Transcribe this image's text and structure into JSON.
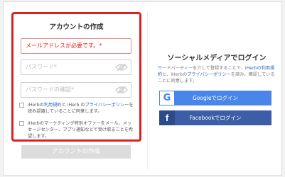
{
  "signup": {
    "title": "アカウントの作成",
    "email_error": "メールアドレスが必要です。*",
    "password_placeholder": "パスワード*",
    "password_confirm_placeholder": "パスワードの確認*",
    "terms": {
      "prefix": "iHerbの",
      "terms_link": "利用規約",
      "middle": "と iHerb の",
      "privacy_link": "プライバシーポリシー",
      "suffix": "を読み認識していることに同意します。"
    },
    "marketing_text": "iHerbのマーケティング特別オファーをメール、メッセージセンター、アプリ通知などで受け取ることを希望します。",
    "create_button": "アカウントの作成"
  },
  "social": {
    "title": "ソーシャルメディアでログイン",
    "note": {
      "prefix": "サードパーティーを介して登録することで、",
      "terms_link": "iHerbの利用規約",
      "middle": "と、iHerbの",
      "privacy_link": "プライバシーポリシー",
      "suffix": "を読み、確認していることに同意します。"
    },
    "google_label": "Googleでログイン",
    "facebook_label": "Facebookでログイン",
    "google_icon_glyph": "G",
    "facebook_icon_glyph": "f"
  },
  "colors": {
    "error_red": "#e0201f",
    "link_blue": "#2a66b5",
    "google_blue": "#4a86e8",
    "facebook_blue": "#3b5ea6"
  }
}
